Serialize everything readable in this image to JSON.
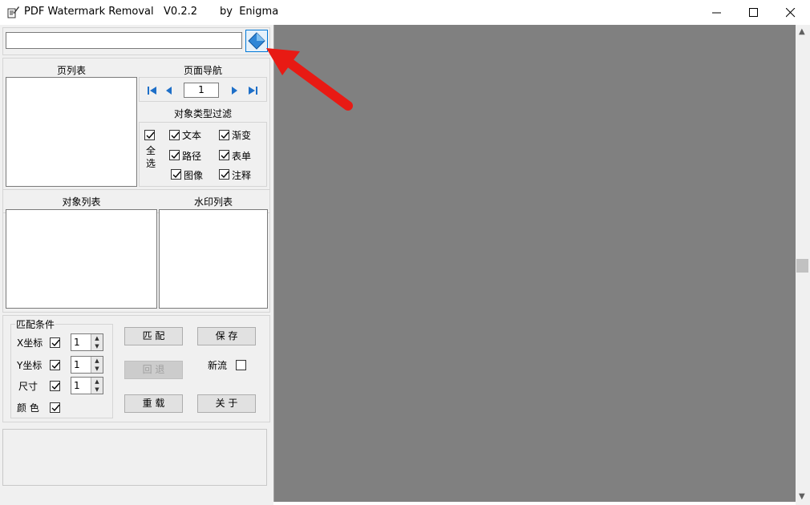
{
  "window": {
    "title": "PDF Watermark Removal   V0.2.2",
    "author": "by  Enigma"
  },
  "file": {
    "path_value": ""
  },
  "pages": {
    "header": "页列表"
  },
  "nav": {
    "header": "页面导航",
    "page_number": "1"
  },
  "filter": {
    "header": "对象类型过滤",
    "select_all": "全选",
    "items": [
      "文本",
      "渐变",
      "路径",
      "表单",
      "图像",
      "注释"
    ]
  },
  "objects": {
    "header": "对象列表"
  },
  "watermarks": {
    "header": "水印列表"
  },
  "match": {
    "header": "匹配条件",
    "x_label": "X坐标",
    "y_label": "Y坐标",
    "size_label": "尺寸",
    "color_label": "颜 色",
    "x_value": "1",
    "y_value": "1",
    "size_value": "1"
  },
  "actions": {
    "match_label": "匹 配",
    "save_label": "保 存",
    "undo_label": "回 退",
    "newflow_label": "新流",
    "reload_label": "重 载",
    "about_label": "关 于"
  },
  "colors": {
    "viewer_bg": "#808080",
    "panel_bg": "#f0f0f0",
    "annotation_arrow": "#e81a14",
    "nav_icon": "#1e6fc8"
  }
}
